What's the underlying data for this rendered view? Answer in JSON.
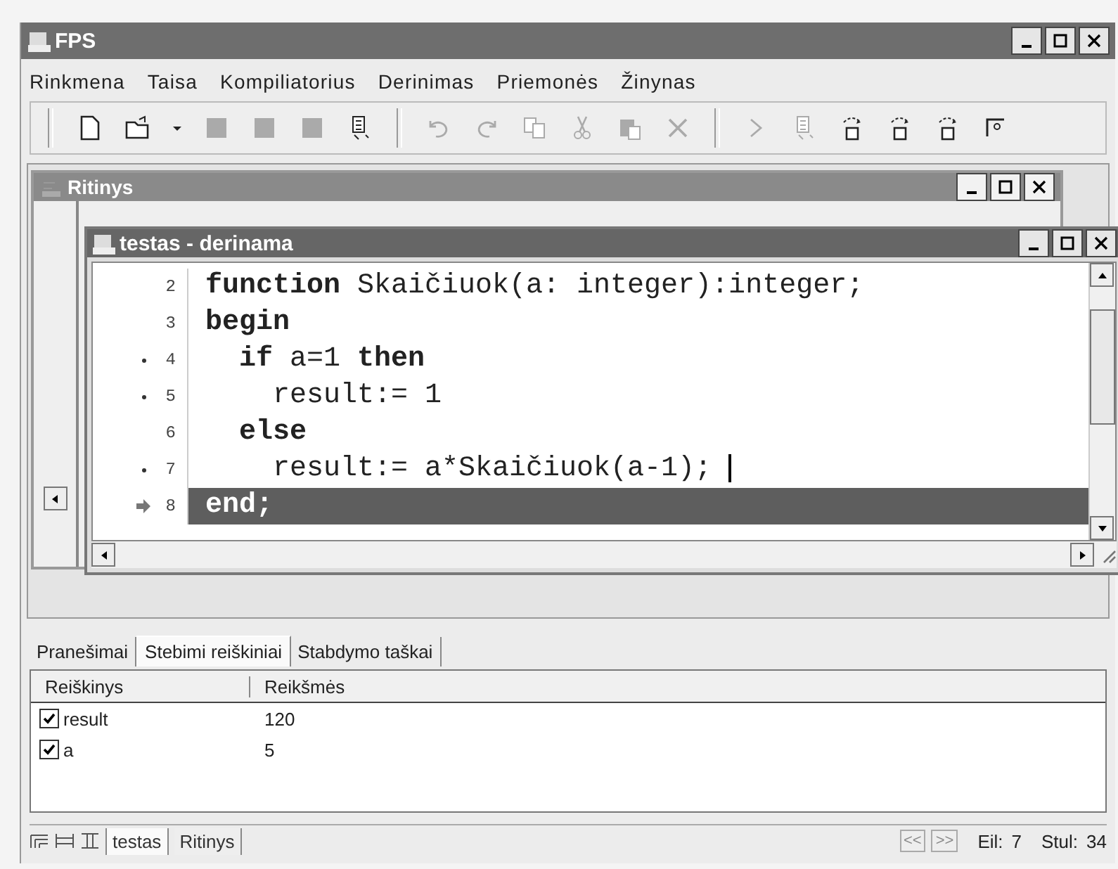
{
  "window": {
    "title": "FPS"
  },
  "menu": [
    "Rinkmena",
    "Taisa",
    "Kompiliatorius",
    "Derinimas",
    "Priemonės",
    "Žinynas"
  ],
  "toolbar": [
    [
      {
        "kind": "page",
        "disabled": false
      },
      {
        "kind": "folder",
        "disabled": false
      },
      {
        "kind": "caret",
        "disabled": false
      },
      {
        "kind": "square",
        "disabled": true
      },
      {
        "kind": "square",
        "disabled": true
      },
      {
        "kind": "square",
        "disabled": true
      },
      {
        "kind": "pages",
        "disabled": false
      }
    ],
    [
      {
        "kind": "undo",
        "disabled": true
      },
      {
        "kind": "redo",
        "disabled": true
      },
      {
        "kind": "copy",
        "disabled": true
      },
      {
        "kind": "cut",
        "disabled": true
      },
      {
        "kind": "paste",
        "disabled": true
      },
      {
        "kind": "cross",
        "disabled": true
      }
    ],
    [
      {
        "kind": "trace",
        "disabled": true
      },
      {
        "kind": "pages",
        "disabled": true
      },
      {
        "kind": "step",
        "disabled": false
      },
      {
        "kind": "step",
        "disabled": false
      },
      {
        "kind": "step",
        "disabled": false
      },
      {
        "kind": "frame",
        "disabled": false
      }
    ]
  ],
  "back_window": {
    "title": "Ritinys"
  },
  "editor": {
    "title": "testas - derinama",
    "lines": [
      {
        "number": "2",
        "text": "**function** Skaičiuok(a: integer):integer;",
        "breakpoint": false,
        "current": false,
        "cursor": false
      },
      {
        "number": "3",
        "text": "**begin**",
        "breakpoint": false,
        "current": false,
        "cursor": false
      },
      {
        "number": "4",
        "text": "  **if** a=1 **then**",
        "breakpoint": true,
        "current": false,
        "cursor": false
      },
      {
        "number": "5",
        "text": "    result:= 1",
        "breakpoint": true,
        "current": false,
        "cursor": false
      },
      {
        "number": "6",
        "text": "  **else**",
        "breakpoint": false,
        "current": false,
        "cursor": false
      },
      {
        "number": "7",
        "text": "    result:= a*Skaičiuok(a-1); ",
        "breakpoint": true,
        "current": false,
        "cursor": true
      },
      {
        "number": "8",
        "text": "end;",
        "breakpoint": false,
        "current": true,
        "cursor": false
      }
    ]
  },
  "tabs": [
    {
      "label": "Pranešimai",
      "selected": false
    },
    {
      "label": "Stebimi reiškiniai",
      "selected": true
    },
    {
      "label": "Stabdymo taškai",
      "selected": false
    }
  ],
  "watch": {
    "columns": [
      "Reiškinys",
      "Reikšmės"
    ],
    "rows": [
      {
        "name": "result",
        "value": "120",
        "checked": true
      },
      {
        "name": "a",
        "value": "5",
        "checked": true
      }
    ]
  },
  "status_bar": {
    "windows": [
      {
        "label": "testas",
        "selected": true
      },
      {
        "label": "Ritinys",
        "selected": false
      }
    ],
    "nav": [
      "<<",
      ">>"
    ],
    "line_label": "Eil:",
    "line": "7",
    "col_label": "Stul:",
    "col": "34"
  }
}
